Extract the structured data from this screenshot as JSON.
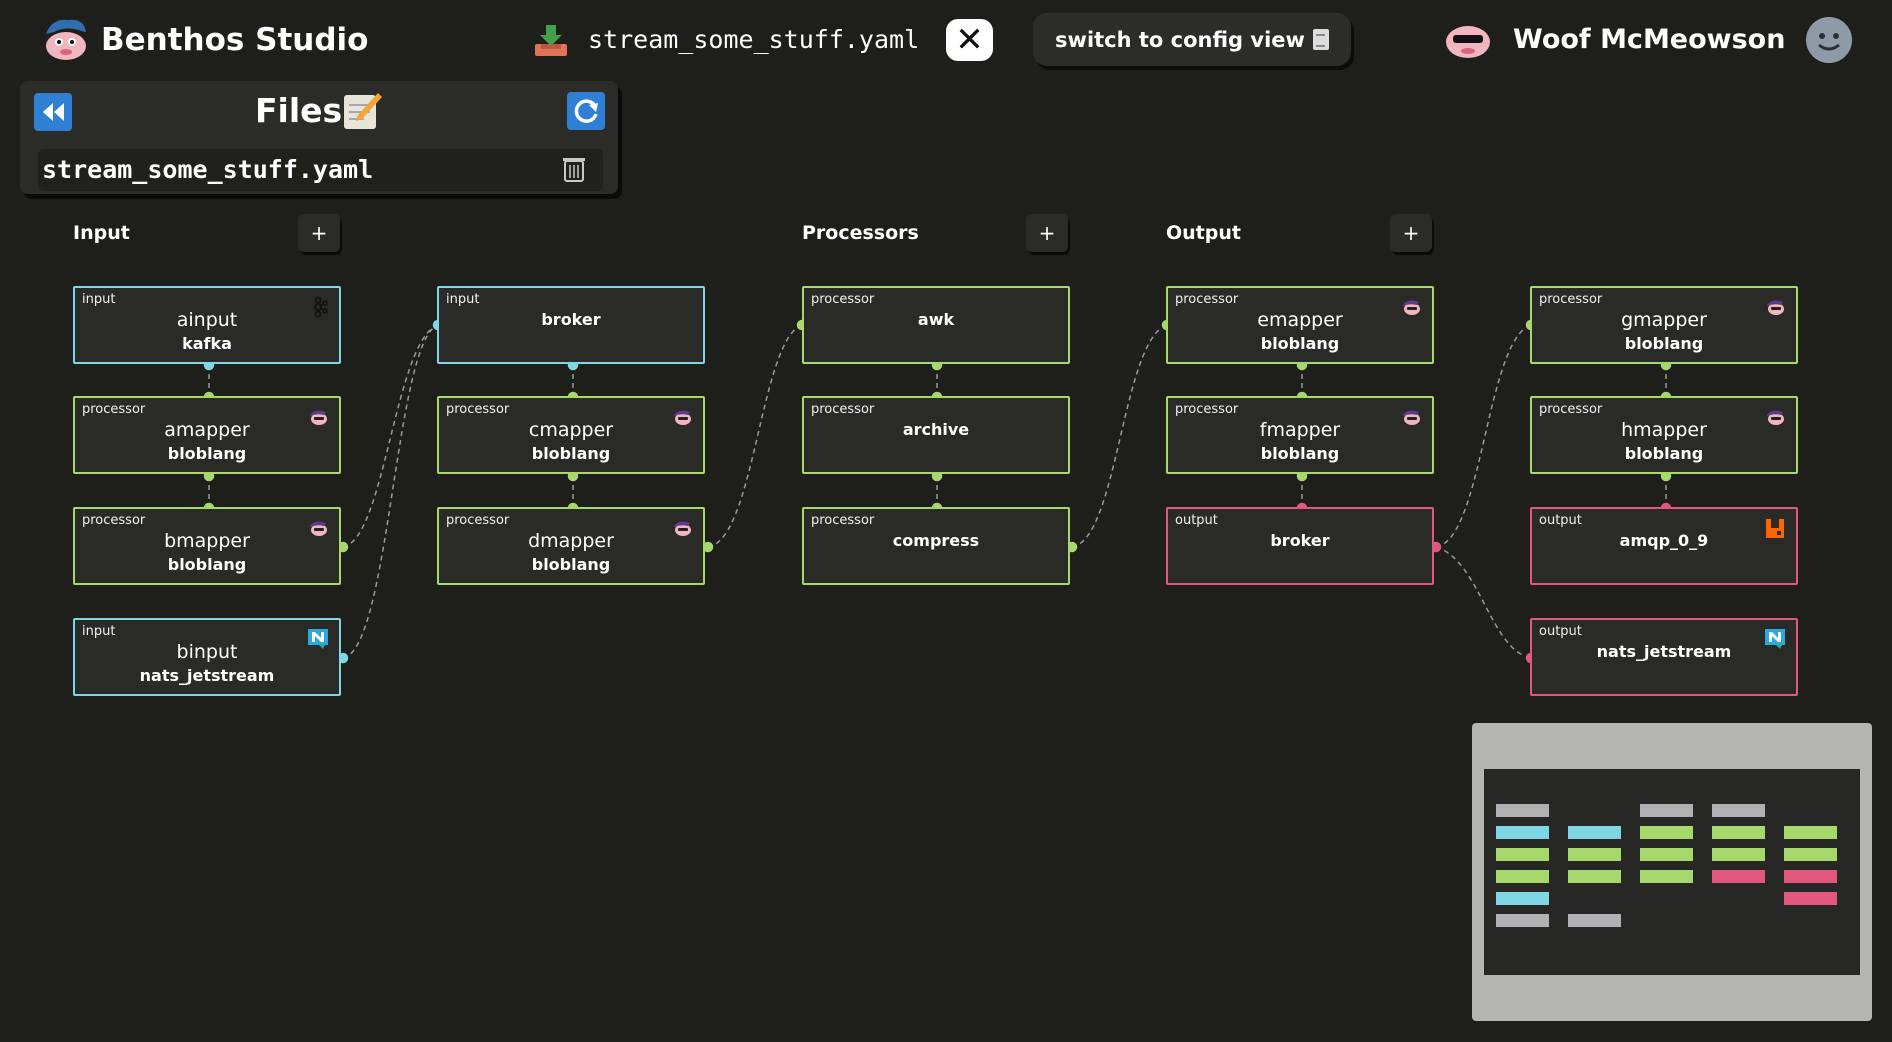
{
  "header": {
    "app_title": "Benthos Studio",
    "file_title": "stream_some_stuff.yaml",
    "close_glyph": "✕",
    "switch_label": "switch to config view",
    "user_name": "Woof McMeowson",
    "icons": [
      "benthos-logo-icon",
      "download-icon",
      "close-icon",
      "document-icon",
      "user-mascot-icon",
      "avatar-icon"
    ]
  },
  "files_panel": {
    "title": "Files",
    "files": [
      "stream_some_stuff.yaml"
    ],
    "icons": [
      "collapse-icon",
      "edit-icon",
      "refresh-icon",
      "trash-icon"
    ]
  },
  "sections": {
    "input": {
      "label": "Input",
      "add": "+"
    },
    "processors": {
      "label": "Processors",
      "add": "+"
    },
    "output": {
      "label": "Output",
      "add": "+"
    }
  },
  "nodes": [
    {
      "id": "ainput",
      "kind": "input",
      "label": "ainput",
      "type": "kafka",
      "icon": "kafka-icon"
    },
    {
      "id": "amapper",
      "kind": "processor",
      "label": "amapper",
      "type": "bloblang",
      "icon": "bloblang-icon"
    },
    {
      "id": "bmapper",
      "kind": "processor",
      "label": "bmapper",
      "type": "bloblang",
      "icon": "bloblang-icon"
    },
    {
      "id": "binput",
      "kind": "input",
      "label": "binput",
      "type": "nats_jetstream",
      "icon": "nats-icon"
    },
    {
      "id": "ibroker",
      "kind": "input",
      "label": "",
      "type": "broker",
      "icon": ""
    },
    {
      "id": "cmapper",
      "kind": "processor",
      "label": "cmapper",
      "type": "bloblang",
      "icon": "bloblang-icon"
    },
    {
      "id": "dmapper",
      "kind": "processor",
      "label": "dmapper",
      "type": "bloblang",
      "icon": "bloblang-icon"
    },
    {
      "id": "awk",
      "kind": "processor",
      "label": "",
      "type": "awk",
      "icon": ""
    },
    {
      "id": "archive",
      "kind": "processor",
      "label": "",
      "type": "archive",
      "icon": ""
    },
    {
      "id": "compress",
      "kind": "processor",
      "label": "",
      "type": "compress",
      "icon": ""
    },
    {
      "id": "emapper",
      "kind": "processor",
      "label": "emapper",
      "type": "bloblang",
      "icon": "bloblang-icon"
    },
    {
      "id": "fmapper",
      "kind": "processor",
      "label": "fmapper",
      "type": "bloblang",
      "icon": "bloblang-icon"
    },
    {
      "id": "obroker",
      "kind": "output",
      "label": "",
      "type": "broker",
      "icon": ""
    },
    {
      "id": "gmapper",
      "kind": "processor",
      "label": "gmapper",
      "type": "bloblang",
      "icon": "bloblang-icon"
    },
    {
      "id": "hmapper",
      "kind": "processor",
      "label": "hmapper",
      "type": "bloblang",
      "icon": "bloblang-icon"
    },
    {
      "id": "amqp",
      "kind": "output",
      "label": "",
      "type": "amqp_0_9",
      "icon": "rabbitmq-icon"
    },
    {
      "id": "onats",
      "kind": "output",
      "label": "",
      "type": "nats_jetstream",
      "icon": "nats-icon"
    }
  ],
  "colors": {
    "background": "#1e1e1b",
    "input": "#7fd6e5",
    "processor": "#a7d86c",
    "output": "#e2577e",
    "button_blue": "#2f7fd4",
    "minimap_grey": "#b5b6b3"
  }
}
